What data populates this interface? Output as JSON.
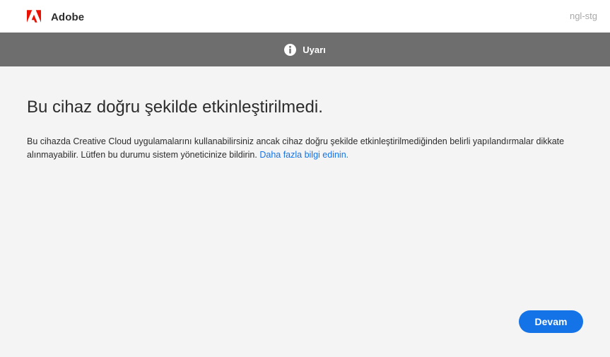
{
  "titlebar": {
    "brand": "Adobe",
    "environment": "ngl-stg",
    "logo_icon": "adobe-logo-icon",
    "brand_color": "#eb1000"
  },
  "banner": {
    "icon": "info-icon",
    "title": "Uyarı"
  },
  "content": {
    "heading": "Bu cihaz doğru şekilde etkinleştirilmedi.",
    "message": "Bu cihazda Creative Cloud uygulamalarını kullanabilirsiniz ancak cihaz doğru şekilde etkinleştirilmediğinden belirli yapılandırmalar dikkate alınmayabilir. Lütfen bu durumu sistem yöneticinize bildirin.",
    "link_label": "Daha fazla bilgi edinin."
  },
  "actions": {
    "continue_label": "Devam",
    "accent_color": "#1473e6"
  }
}
